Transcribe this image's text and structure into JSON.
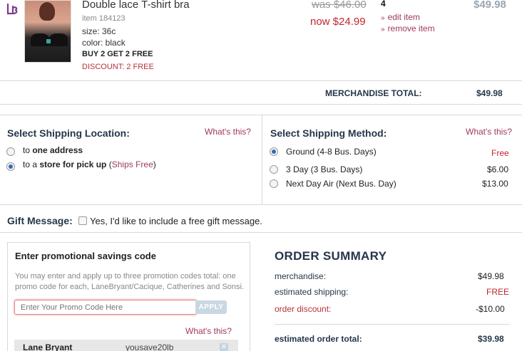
{
  "cart_item": {
    "brand_icon": "lb-logo-icon",
    "title": "Double lace T-shirt bra",
    "item_number": "item 184123",
    "size": "size: 36c",
    "color": "color: black",
    "promo": "BUY 2 GET 2 FREE",
    "discount": "DISCOUNT: 2 FREE",
    "was_price": "was $46.00",
    "now_price": "now $24.99",
    "quantity": "4",
    "edit_label": "edit item",
    "remove_label": "remove item",
    "line_total": "$49.98"
  },
  "merchandise_total": {
    "label": "MERCHANDISE TOTAL:",
    "value": "$49.98"
  },
  "shipping_location": {
    "title": "Select Shipping Location:",
    "whats_this": "What's this?",
    "options": [
      {
        "prefix": "to ",
        "bold": "one address",
        "suffix": "",
        "checked": false
      },
      {
        "prefix": "to a ",
        "bold": "store for pick up",
        "suffix": " (",
        "note": "Ships Free",
        "after": ")",
        "checked": true
      }
    ]
  },
  "shipping_method": {
    "title": "Select Shipping Method:",
    "whats_this": "What's this?",
    "options": [
      {
        "label": "Ground (4-8 Bus. Days)",
        "price": "Free",
        "checked": true
      },
      {
        "label": "3 Day (3 Bus. Days)",
        "price": "$6.00",
        "checked": false
      },
      {
        "label": "Next Day Air (Next Bus. Day)",
        "price": "$13.00",
        "checked": false
      }
    ]
  },
  "gift": {
    "label": "Gift Message:",
    "checkbox_text": "Yes, I'd like to include a free gift message."
  },
  "promo": {
    "title": "Enter promotional savings code",
    "description": "You may enter and apply up to three promotion codes total: one promo code for each, LaneBryant/Cacique, Catherines and Sonsi.",
    "placeholder": "Enter Your Promo Code Here",
    "apply_label": "APPLY",
    "whats_this": "What's this?",
    "applied": {
      "brand": "Lane Bryant",
      "code": "yousave20lb"
    }
  },
  "order_summary": {
    "title": "ORDER SUMMARY",
    "merchandise_label": "merchandise:",
    "merchandise_value": "$49.98",
    "shipping_label": "estimated shipping:",
    "shipping_value": "FREE",
    "discount_label": "order discount:",
    "discount_value": "-$10.00",
    "total_label": "estimated order total:",
    "total_value": "$39.98"
  },
  "colors": {
    "accent_link": "#a03a5b",
    "price_red": "#c0262e",
    "navy_heading": "#26364a",
    "radio_checked": "#2f6db5"
  }
}
